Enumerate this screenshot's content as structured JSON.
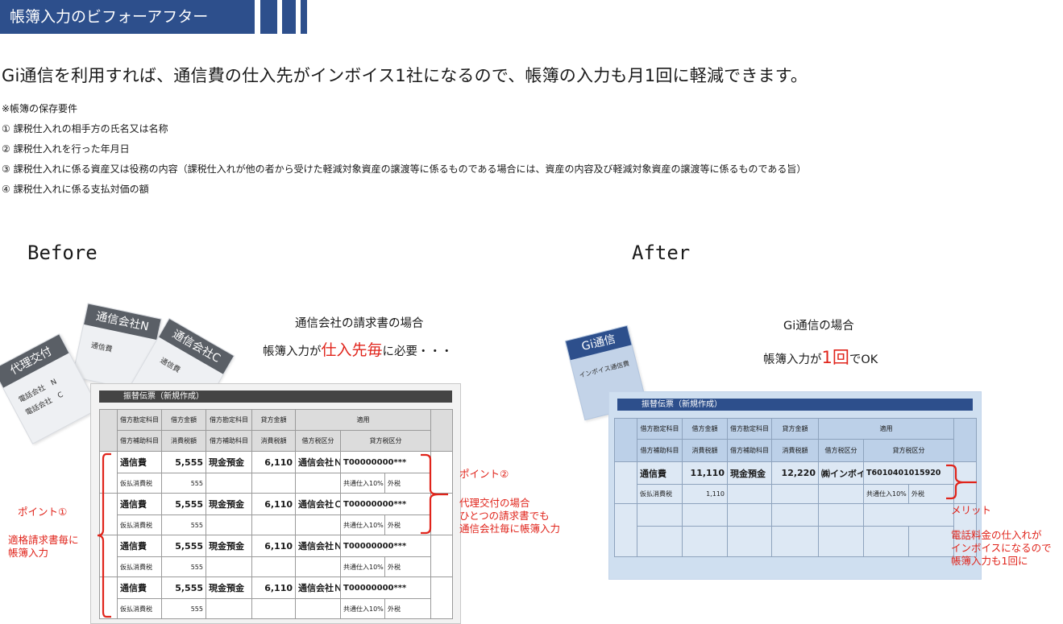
{
  "header": {
    "title": "帳簿入力のビフォーアフター"
  },
  "headline": "Gi通信を利用すれば、通信費の仕入先がインボイス1社になるので、帳簿の入力も月1回に軽減できます。",
  "requirements": {
    "title": "※帳簿の保存要件",
    "items": [
      "① 課税仕入れの相手方の氏名又は名称",
      "② 課税仕入れを行った年月日",
      "③ 課税仕入れに係る資産又は役務の内容（課税仕入れが他の者から受けた軽減対象資産の譲渡等に係るものである場合には、資産の内容及び軽減対象資産の譲渡等に係るものである旨）",
      "④ 課税仕入れに係る支払対価の額"
    ]
  },
  "before": {
    "label": "Before",
    "caption_line1": "通信会社の請求書の場合",
    "caption_pre": "帳簿入力が",
    "caption_em": "仕入先毎",
    "caption_post": "に必要・・・",
    "cards": {
      "agent": {
        "tag": "代理交付",
        "line1": "電話会社　N",
        "line2": "電話会社　C"
      },
      "n": {
        "tag": "通信会社N",
        "line1": "通信費"
      },
      "c": {
        "tag": "通信会社C",
        "line1": "通信費"
      }
    },
    "form_title": "振替伝票（新規作成）",
    "headers": {
      "debit_account": "借方勘定科目",
      "debit_amount": "借方金額",
      "credit_account": "借方勘定科目",
      "credit_amount": "貸方金額",
      "summary": "適用",
      "debit_sub": "借方補助科目",
      "debit_tax": "消費税額",
      "credit_sub": "借方補助科目",
      "credit_tax": "消費税額",
      "debit_tax_cat": "借方税区分",
      "credit_tax_cat": "貸方税区分"
    },
    "rows": [
      {
        "account": "通信費",
        "amount": "5,555",
        "credit": "現金預金",
        "credit_amount": "6,110",
        "partner": "通信会社Ｎ",
        "invoice_no": "T00000000***",
        "sub": "仮払消費税",
        "tax": "555",
        "tax_cat": "共通仕入10%",
        "tax_type": "外税"
      },
      {
        "account": "通信費",
        "amount": "5,555",
        "credit": "現金預金",
        "credit_amount": "6,110",
        "partner": "通信会社Ｃ",
        "invoice_no": "T00000000***",
        "sub": "仮払消費税",
        "tax": "555",
        "tax_cat": "共通仕入10%",
        "tax_type": "外税"
      },
      {
        "account": "通信費",
        "amount": "5,555",
        "credit": "現金預金",
        "credit_amount": "6,110",
        "partner": "通信会社Ｎ",
        "invoice_no": "T00000000***",
        "sub": "仮払消費税",
        "tax": "555",
        "tax_cat": "共通仕入10%",
        "tax_type": "外税"
      },
      {
        "account": "通信費",
        "amount": "5,555",
        "credit": "現金預金",
        "credit_amount": "6,110",
        "partner": "通信会社Ｎ",
        "invoice_no": "T00000000***",
        "sub": "仮払消費税",
        "tax": "555",
        "tax_cat": "共通仕入10%",
        "tax_type": "外税"
      }
    ],
    "point1_title": "ポイント①",
    "point1_line1": "適格請求書毎に",
    "point1_line2": "帳簿入力",
    "point2_title": "ポイント②",
    "point2_line1": "代理交付の場合",
    "point2_line2": "ひとつの請求書でも",
    "point2_line3": "通信会社毎に帳簿入力"
  },
  "after": {
    "label": "After",
    "caption_line1": "Gi通信の場合",
    "caption_pre": "帳簿入力が",
    "caption_em": "1回",
    "caption_post": "でOK",
    "card": {
      "tag": "Gi通信",
      "line1": "インボイス通信費"
    },
    "form_title": "振替伝票（新規作成）",
    "row": {
      "account": "通信費",
      "amount": "11,110",
      "credit": "現金預金",
      "credit_amount": "12,220",
      "partner": "㈱インボイス",
      "invoice_no": "T6010401015920",
      "sub": "仮払消費税",
      "tax": "1,110",
      "tax_cat": "共通仕入10%",
      "tax_type": "外税"
    },
    "merit_title": "メリット",
    "merit_line1": "電話料金の仕入れが",
    "merit_line2": "インボイスになるので",
    "merit_line3": "帳簿入力も1回に"
  }
}
